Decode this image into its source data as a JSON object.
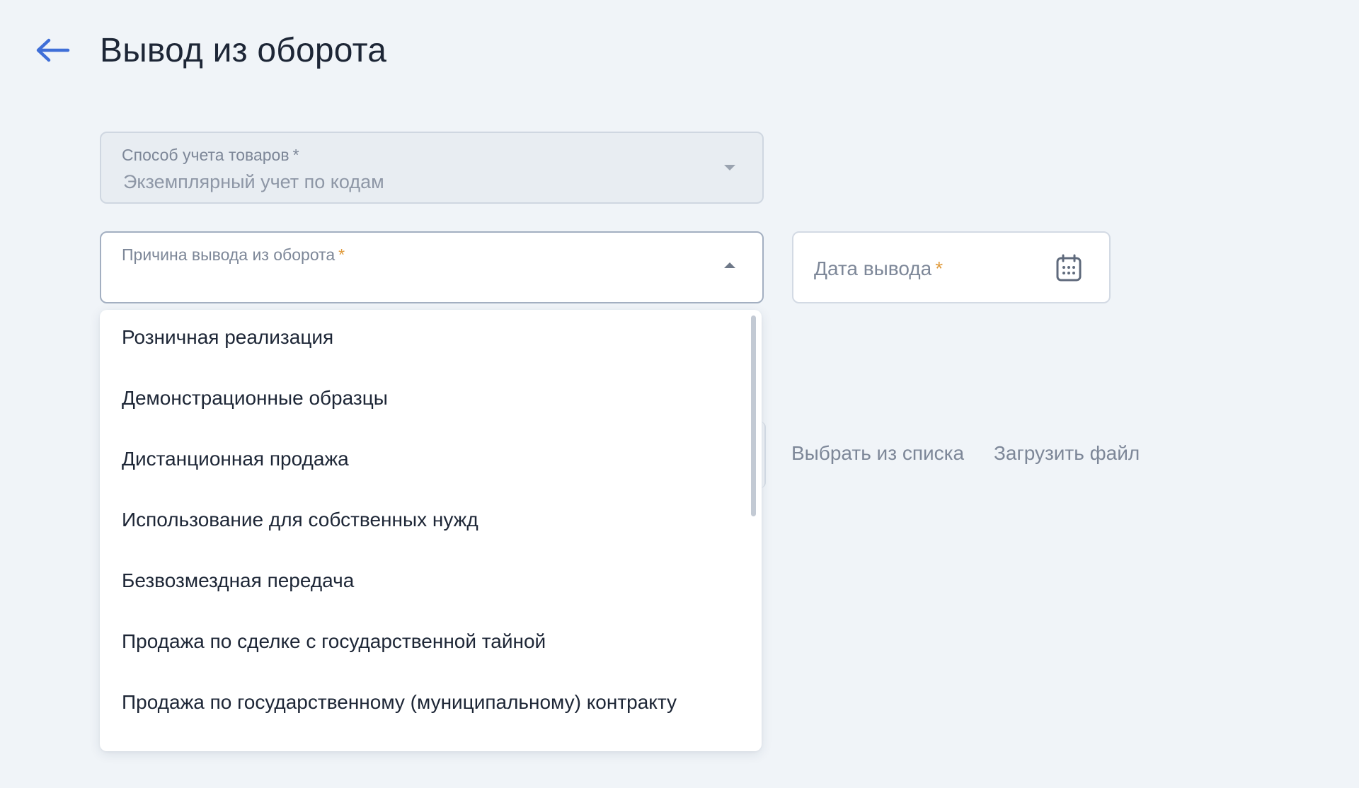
{
  "page": {
    "title": "Вывод из оборота"
  },
  "accounting_method": {
    "label": "Способ учета товаров",
    "required_mark": "*",
    "value": "Экземплярный учет по кодам"
  },
  "withdrawal_reason": {
    "label": "Причина вывода из оборота",
    "required_mark": "*",
    "options": [
      "Розничная реализация",
      "Демонстрационные образцы",
      "Дистанционная продажа",
      "Использование для собственных нужд",
      "Безвозмездная передача",
      "Продажа по сделке с государственной тайной",
      "Продажа по государственному (муниципальному) контракту"
    ]
  },
  "withdrawal_date": {
    "label": "Дата вывода",
    "required_mark": "*"
  },
  "actions": {
    "select_from_list": "Выбрать из списка",
    "upload_file": "Загрузить файл"
  },
  "icons": {
    "back": "arrow-left-icon",
    "calendar": "calendar-icon",
    "dropdown_closed": "chevron-down-icon",
    "dropdown_open": "chevron-up-icon"
  },
  "colors": {
    "accent": "#3f6fd8",
    "required_accent": "#e09b3d",
    "background": "#f0f4f8"
  }
}
